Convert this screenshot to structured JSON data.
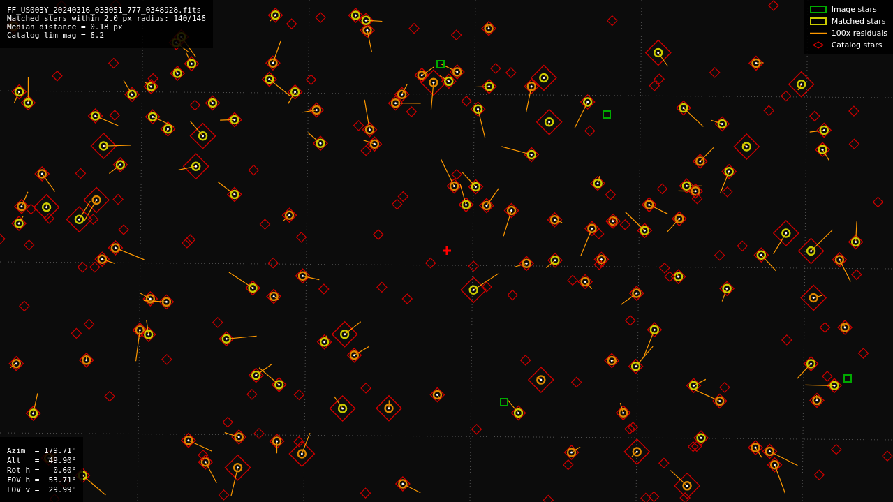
{
  "header": {
    "lines": [
      "FF_US003Y_20240316_033051_777_0348928.fits",
      "Matched stars within 2.0 px radius: 140/146",
      "Median distance = 0.18 px",
      "Catalog lim mag = 6.2"
    ]
  },
  "legend": {
    "items": [
      {
        "kind": "image",
        "label": "Image stars"
      },
      {
        "kind": "matched",
        "label": "Matched stars"
      },
      {
        "kind": "residual",
        "label": "100x residuals"
      },
      {
        "kind": "catalog",
        "label": "Catalog stars"
      }
    ]
  },
  "pointing": {
    "lines": [
      "Azim  = 179.71°",
      "Alt   =  49.90°",
      "Rot h =   0.60°",
      "FOV h =  53.71°",
      "FOV v =  29.99°"
    ]
  }
}
